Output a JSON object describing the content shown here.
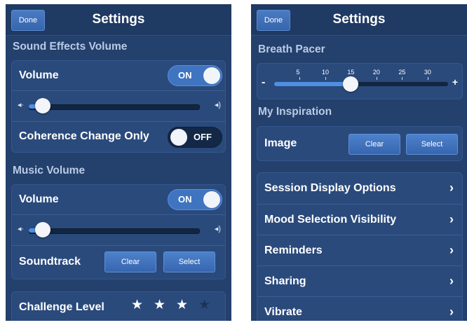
{
  "left": {
    "done_label": "Done",
    "title": "Settings",
    "sound_effects": {
      "section_title": "Sound Effects Volume",
      "volume_label": "Volume",
      "volume_toggle": "ON",
      "volume_level": 0.05,
      "coherence_label": "Coherence Change Only",
      "coherence_toggle": "OFF"
    },
    "music": {
      "section_title": "Music Volume",
      "volume_label": "Volume",
      "volume_toggle": "ON",
      "volume_level": 0.05,
      "soundtrack_label": "Soundtrack",
      "clear_label": "Clear",
      "select_label": "Select"
    },
    "challenge": {
      "label": "Challenge Level",
      "rating": 3,
      "max": 4
    }
  },
  "right": {
    "done_label": "Done",
    "title": "Settings",
    "breath_pacer": {
      "section_title": "Breath Pacer",
      "ticks": [
        "5",
        "10",
        "15",
        "20",
        "25",
        "30"
      ],
      "minus": "-",
      "plus": "+",
      "value": 15
    },
    "inspiration": {
      "section_title": "My Inspiration",
      "image_label": "Image",
      "clear_label": "Clear",
      "select_label": "Select"
    },
    "menu": [
      {
        "label": "Session Display Options"
      },
      {
        "label": "Mood Selection Visibility"
      },
      {
        "label": "Reminders"
      },
      {
        "label": "Sharing"
      },
      {
        "label": "Vibrate"
      }
    ]
  },
  "colors": {
    "background": "#24406c",
    "accent": "#3f74c0",
    "section_title": "#b9cbe6"
  },
  "icons": {
    "speaker_low": "speaker-low-icon",
    "speaker_high": "speaker-high-icon",
    "chevron": "chevron-right-icon",
    "star": "star-icon"
  }
}
